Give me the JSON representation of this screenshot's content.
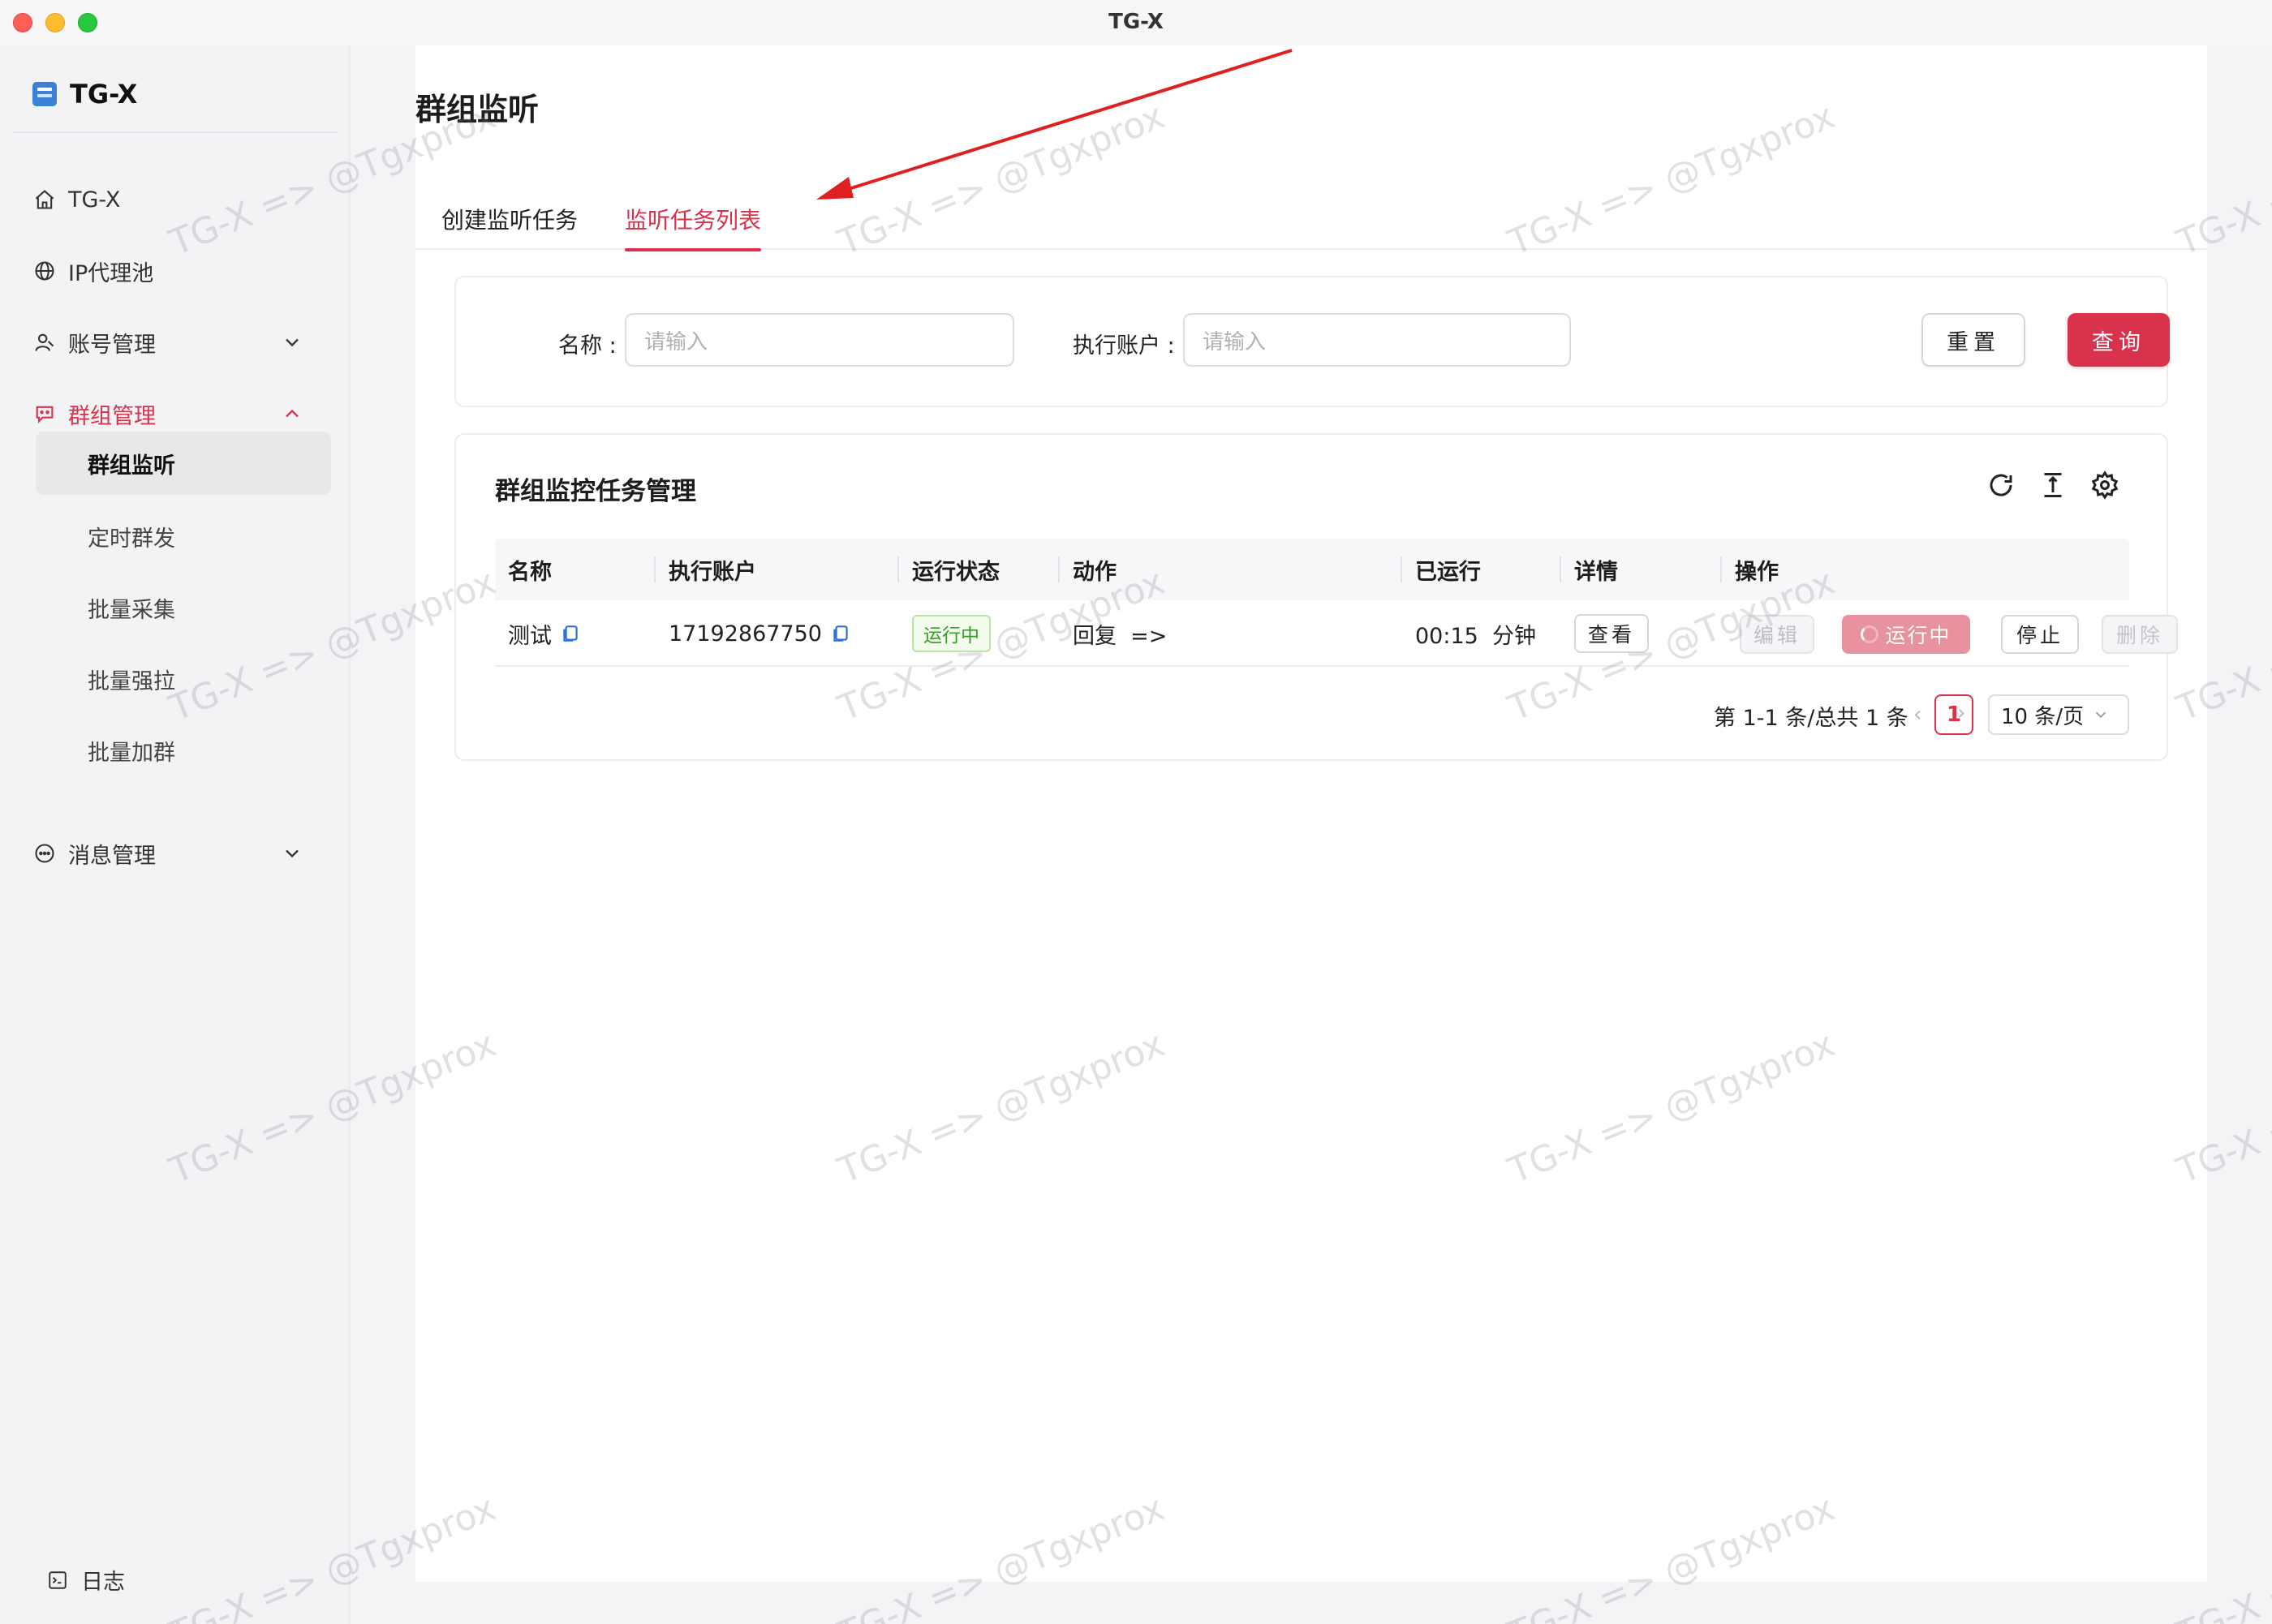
{
  "window": {
    "title": "TG-X"
  },
  "sidebar": {
    "brand": "TG-X",
    "items": [
      {
        "label": "TG-X",
        "icon": "home-icon"
      },
      {
        "label": "IP代理池",
        "icon": "globe-icon"
      },
      {
        "label": "账号管理",
        "icon": "user-icon",
        "expanded": false
      },
      {
        "label": "群组管理",
        "icon": "chat-group-icon",
        "expanded": true,
        "active": true
      },
      {
        "label": "消息管理",
        "icon": "message-icon",
        "expanded": false
      }
    ],
    "group_sub_items": [
      {
        "label": "群组监听",
        "selected": true
      },
      {
        "label": "定时群发"
      },
      {
        "label": "批量采集"
      },
      {
        "label": "批量强拉"
      },
      {
        "label": "批量加群"
      }
    ],
    "log_label": "日志"
  },
  "page": {
    "title": "群组监听",
    "tabs": [
      {
        "label": "创建监听任务",
        "active": false
      },
      {
        "label": "监听任务列表",
        "active": true
      }
    ]
  },
  "search": {
    "name_label": "名称 :",
    "name_placeholder": "请输入",
    "account_label": "执行账户 :",
    "account_placeholder": "请输入",
    "reset_label": "重置",
    "query_label": "查询"
  },
  "table": {
    "title": "群组监控任务管理",
    "columns": [
      "名称",
      "执行账户",
      "运行状态",
      "动作",
      "已运行",
      "详情",
      "操作"
    ],
    "rows": [
      {
        "name": "测试",
        "account": "17192867750",
        "status": "运行中",
        "action": "回复  =>",
        "elapsed": "00:15  分钟",
        "detail_label": "查看",
        "ops": {
          "edit": "编辑",
          "running": "运行中",
          "stop": "停止",
          "delete": "删除"
        }
      }
    ],
    "pagination": {
      "summary": "第 1-1 条/总共 1 条",
      "current_page": "1",
      "page_size": "10 条/页"
    }
  },
  "watermark": "TG-X => @Tgxprox",
  "colors": {
    "accent": "#d9324d",
    "success": "#3a9a2a",
    "annotation": "#e02020"
  }
}
